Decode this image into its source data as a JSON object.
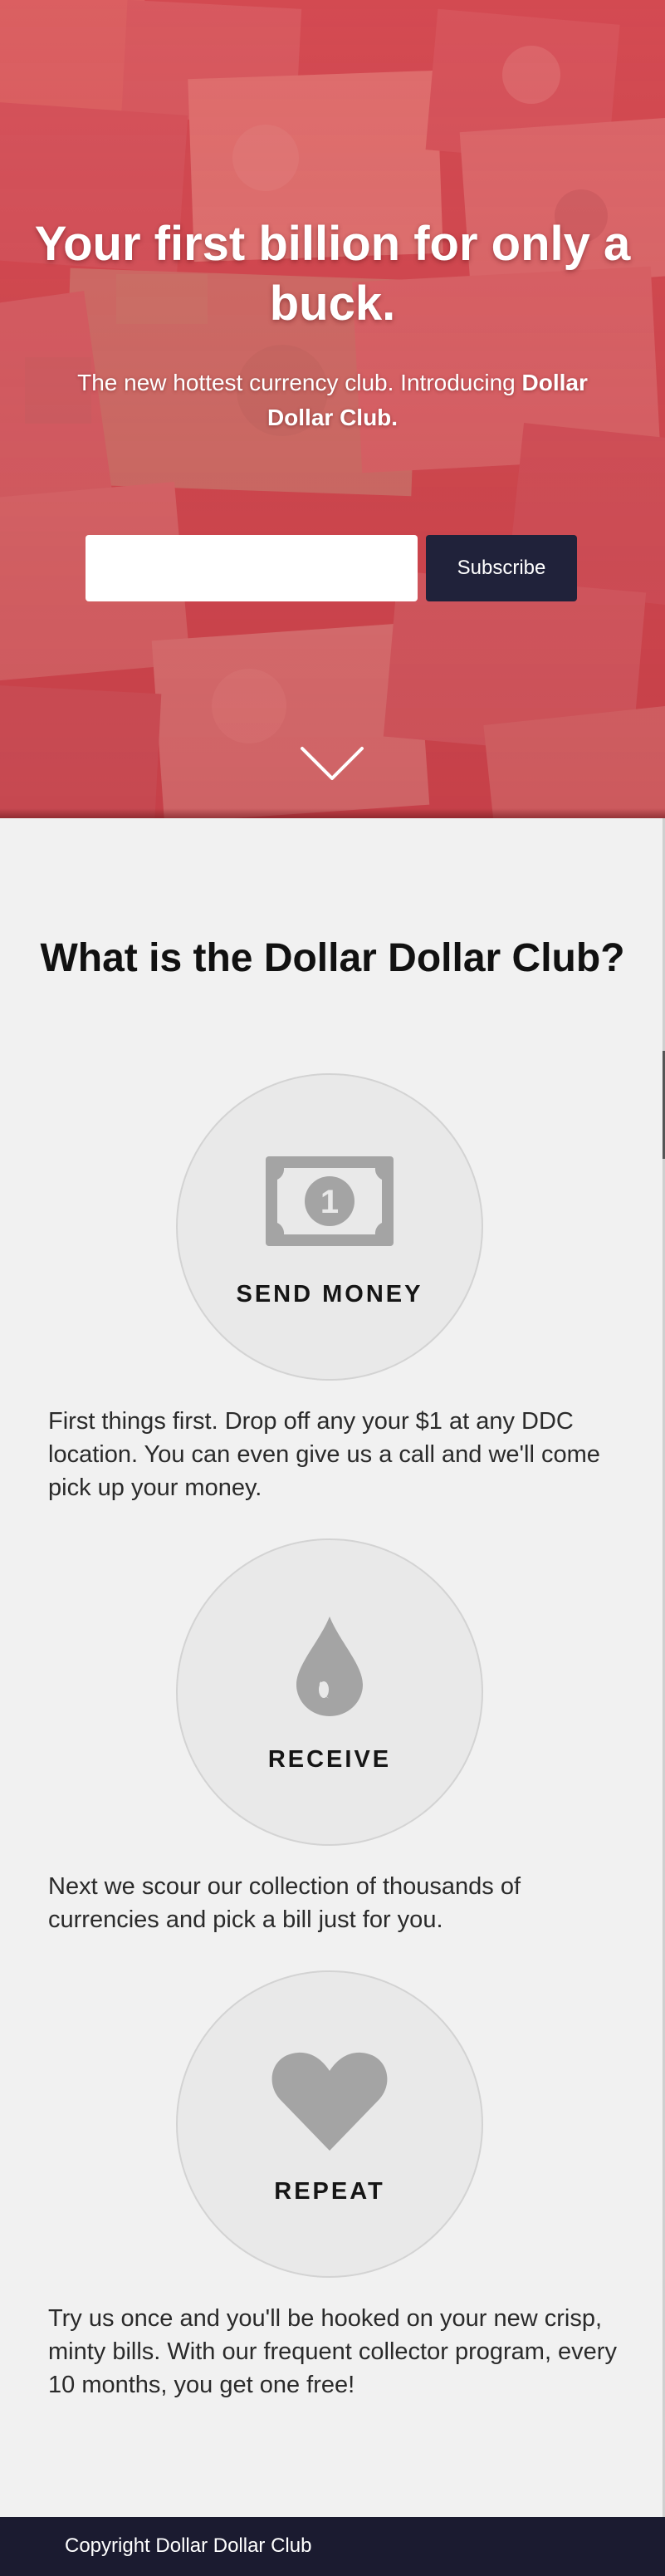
{
  "hero": {
    "title": "Your first billion for only a buck.",
    "subtitle_intro": "The new hottest currency club. Introducing",
    "subtitle_brand": "Dollar Dollar Club.",
    "email_value": "",
    "subscribe_label": "Subscribe",
    "background_icon": "banknotes-collage",
    "scroll_icon": "chevron-down-icon"
  },
  "about": {
    "title": "What is the Dollar Dollar Club?",
    "steps": [
      {
        "label": "SEND MONEY",
        "icon": "money-bill-icon",
        "description": "First things first. Drop off any your $1 at any DDC location. You can even give us a call and we'll come pick up your money."
      },
      {
        "label": "RECEIVE",
        "icon": "droplet-icon",
        "description": "Next we scour our collection of thousands of currencies and pick a bill just for you."
      },
      {
        "label": "REPEAT",
        "icon": "heart-icon",
        "description": "Try us once and you'll be hooked on your new crisp, minty bills. With our frequent collector program, every 10 months, you get one free!"
      }
    ]
  },
  "footer": {
    "copyright": "Copyright Dollar Dollar Club"
  },
  "colors": {
    "hero_tint": "#d9474f",
    "button_bg": "#20223a",
    "footer_bg": "#1b1b30",
    "page_bg": "#f1f1f1",
    "circle_bg": "#e9e9e9",
    "icon_gray": "#a4a4a4"
  }
}
